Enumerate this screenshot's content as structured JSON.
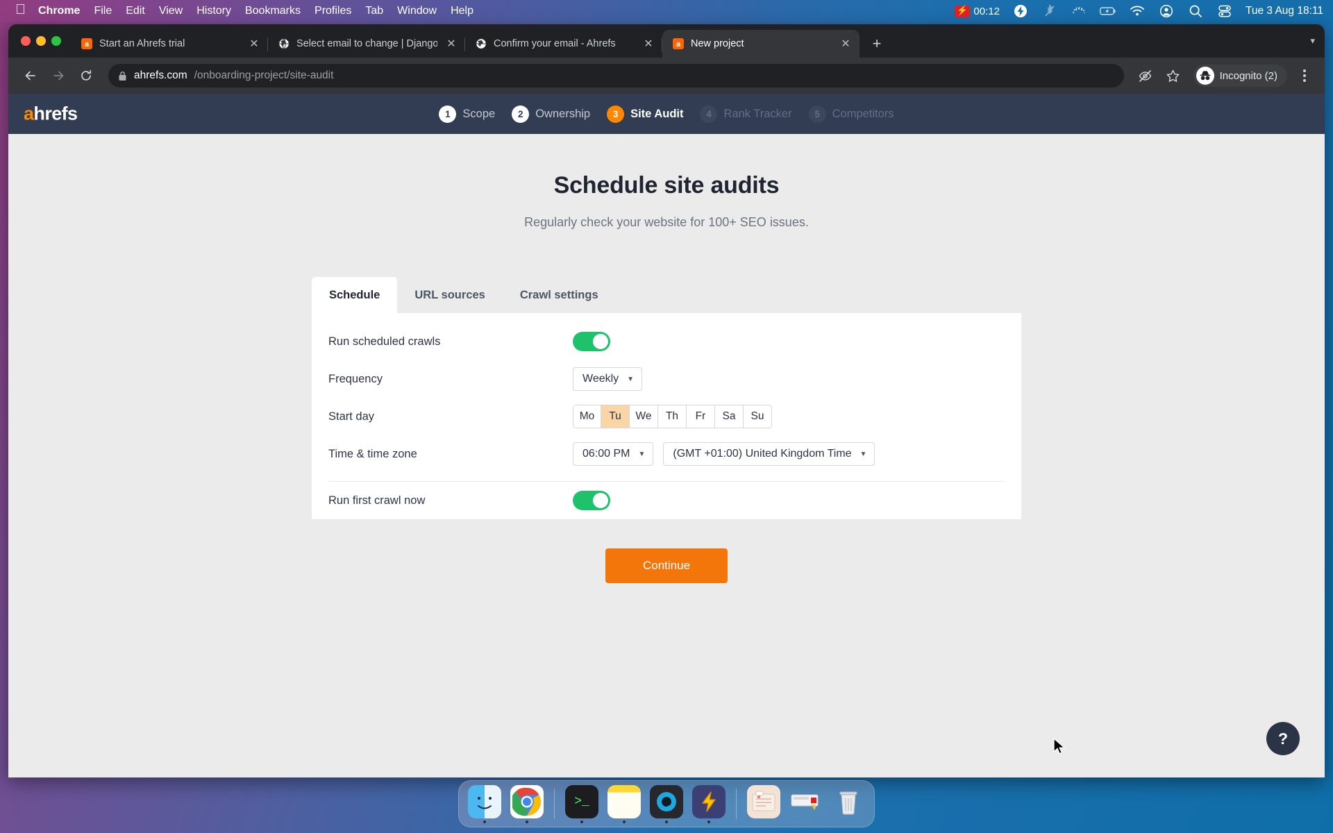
{
  "menubar": {
    "apple_icon": "apple-logo-icon",
    "items": [
      {
        "label": "Chrome",
        "bold": true
      },
      {
        "label": "File",
        "bold": false
      },
      {
        "label": "Edit",
        "bold": false
      },
      {
        "label": "View",
        "bold": false
      },
      {
        "label": "History",
        "bold": false
      },
      {
        "label": "Bookmarks",
        "bold": false
      },
      {
        "label": "Profiles",
        "bold": false
      },
      {
        "label": "Tab",
        "bold": false
      },
      {
        "label": "Window",
        "bold": false
      },
      {
        "label": "Help",
        "bold": false
      }
    ],
    "recording": {
      "icon": "screen-recording-icon",
      "time": "00:12"
    },
    "status_icons": [
      "lightning-bolt-icon",
      "bluetooth-off-icon",
      "keyboard-brightness-icon",
      "battery-charging-icon",
      "wifi-icon",
      "control-center-account-icon",
      "spotlight-search-icon",
      "control-center-icon"
    ],
    "clock": "Tue 3 Aug  18:11"
  },
  "browser": {
    "tabs": [
      {
        "title": "Start an Ahrefs trial",
        "favicon": "ahrefs-favicon",
        "active": false
      },
      {
        "title": "Select email to change | Django",
        "favicon": "globe-favicon",
        "active": false
      },
      {
        "title": "Confirm your email - Ahrefs",
        "favicon": "globe-favicon",
        "active": false
      },
      {
        "title": "New project",
        "favicon": "ahrefs-favicon",
        "active": true
      }
    ],
    "new_tab_label": "+",
    "tabstrip_caret": "▾",
    "toolbar": {
      "back_icon": "back-arrow-icon",
      "forward_icon": "forward-arrow-icon",
      "reload_icon": "reload-icon",
      "lock_icon": "lock-icon",
      "url_host": "ahrefs.com",
      "url_path": "/onboarding-project/site-audit",
      "eye_icon": "eye-slash-icon",
      "bookmark_icon": "star-icon",
      "incognito_label": "Incognito (2)",
      "incognito_icon": "incognito-icon",
      "menu_icon": "kebab-menu-icon"
    }
  },
  "app": {
    "logo": {
      "accent_letter": "a",
      "rest": "hrefs"
    },
    "brand_color": "#ff8800",
    "stepper": [
      {
        "num": "1",
        "label": "Scope",
        "state": "done"
      },
      {
        "num": "2",
        "label": "Ownership",
        "state": "done"
      },
      {
        "num": "3",
        "label": "Site Audit",
        "state": "active"
      },
      {
        "num": "4",
        "label": "Rank Tracker",
        "state": "todo"
      },
      {
        "num": "5",
        "label": "Competitors",
        "state": "todo"
      }
    ],
    "title": "Schedule site audits",
    "subtitle": "Regularly check your website for 100+ SEO issues.",
    "tabs": [
      {
        "label": "Schedule",
        "active": true
      },
      {
        "label": "URL sources",
        "active": false
      },
      {
        "label": "Crawl settings",
        "active": false
      }
    ],
    "form": {
      "run_scheduled_crawls": {
        "label": "Run scheduled crawls",
        "value": "on"
      },
      "frequency": {
        "label": "Frequency",
        "value": "Weekly",
        "arrow": "▼"
      },
      "start_day": {
        "label": "Start day",
        "days": [
          "Mo",
          "Tu",
          "We",
          "Th",
          "Fr",
          "Sa",
          "Su"
        ],
        "selected": "Tu",
        "selected_color": "#fbd5a5"
      },
      "time_zone": {
        "label": "Time & time zone",
        "time_value": "06:00 PM",
        "zone_value": "(GMT +01:00) United Kingdom Time",
        "arrow": "▼"
      },
      "run_first_crawl": {
        "label": "Run first crawl now",
        "value": "on"
      }
    },
    "continue_label": "Continue",
    "help_label": "?"
  },
  "dock": {
    "items": [
      {
        "name": "finder",
        "glyph": "🙂",
        "running": true
      },
      {
        "name": "chrome",
        "glyph": "◉",
        "running": true
      },
      {
        "name": "terminal",
        "glyph": ">_",
        "running": true
      },
      {
        "name": "notes",
        "glyph": "▤",
        "running": true
      },
      {
        "name": "quicktime",
        "glyph": "◍",
        "running": true
      },
      {
        "name": "lightning-app",
        "glyph": "⚡",
        "running": true
      },
      {
        "name": "folder",
        "glyph": "🗂",
        "running": false
      },
      {
        "name": "device",
        "glyph": "▭",
        "running": false
      },
      {
        "name": "trash",
        "glyph": "🗑",
        "running": false
      }
    ]
  }
}
